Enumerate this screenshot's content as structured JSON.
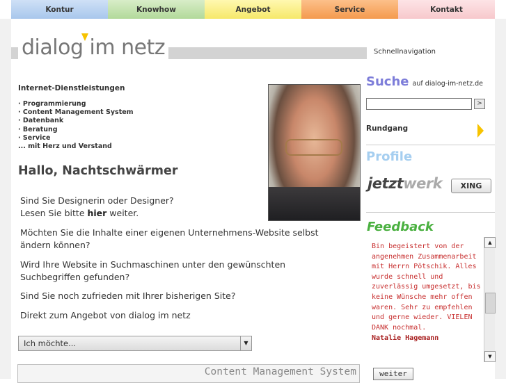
{
  "nav": {
    "tabs": [
      "Kontur",
      "Knowhow",
      "Angebot",
      "Service",
      "Kontakt"
    ]
  },
  "header": {
    "logo_text": "dialog im netz",
    "quicknav": "Schnellnavigation"
  },
  "intro": {
    "title": "Internet-Dienstleistungen",
    "items": [
      "· Programmierung",
      "· Content Management System",
      "· Datenbank",
      "· Beratung",
      "· Service",
      "... mit Herz und Verstand"
    ]
  },
  "main": {
    "greeting": "Hallo, Nachtschwärmer",
    "q1_line1": "Sind Sie Designerin oder Designer?",
    "q1_line2_pre": "Lesen Sie bitte ",
    "q1_line2_link": "hier",
    "q1_line2_post": " weiter.",
    "q2": "Möchten Sie die Inhalte einer eigenen Unternehmens-Website selbst ändern können?",
    "q3": "Wird Ihre Website in Suchmaschinen unter den gewünschten Suchbegriffen gefunden?",
    "q4": "Sind Sie noch zufrieden mit Ihrer bisherigen Site?",
    "q5": "Direkt zum Angebot von dialog im netz",
    "select_value": "Ich möchte...",
    "cms_banner": "Content Management System"
  },
  "sidebar": {
    "search_title": "Suche",
    "search_sub": "auf dialog-im-netz.de",
    "search_value": "",
    "search_btn": ">",
    "tour": "Rundgang",
    "profile_title": "Profile",
    "jetzt_a": "jetzt",
    "jetzt_b": "werk",
    "xing": "XING",
    "feedback_title": "Feedback",
    "feedback_text": "Bin begeistert von der angenehmen Zusammenarbeit mit Herrn Pötschik. Alles wurde schnell und zuverlässig umgesetzt, bis keine Wünsche mehr offen waren. Sehr zu empfehlen und gerne wieder. VIELEN DANK nochmal.",
    "feedback_author": "Natalie Hagemann",
    "weiter": "weiter"
  },
  "colors": {
    "suche": "#7d7dd9",
    "profile": "#a5cef0",
    "feedback": "#4ab040",
    "feedback_text": "#c72e2e",
    "accent_arrow": "#f7c300"
  }
}
